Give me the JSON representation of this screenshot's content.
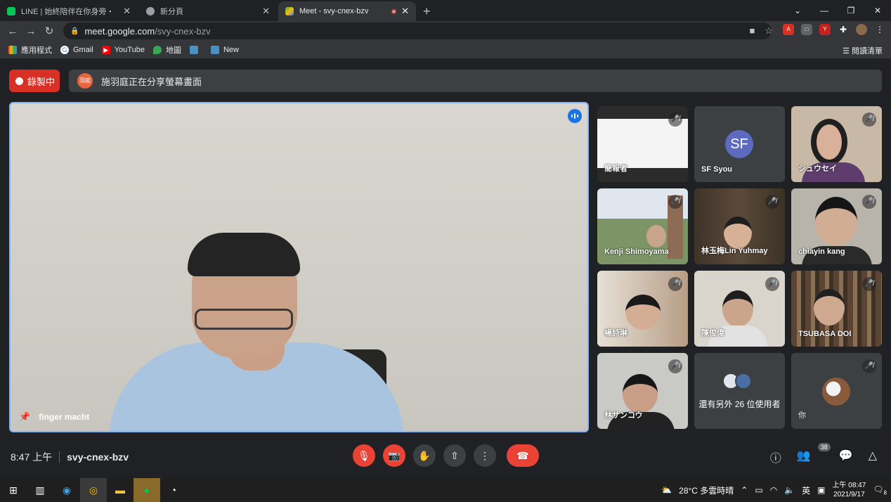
{
  "browser": {
    "tabs": [
      {
        "title": "LINE | 始終陪伴在你身旁・",
        "color": "#06c755"
      },
      {
        "title": "新分頁",
        "color": "#9aa0a6"
      },
      {
        "title": "Meet - svy-cnex-bzv",
        "color": "#34a853",
        "active": true
      }
    ],
    "url_host": "meet.google.com",
    "url_path": "/svy-cnex-bzv",
    "bookmarks": [
      "應用程式",
      "Gmail",
      "YouTube",
      "地圖",
      "New"
    ],
    "reading_list": "閱讀清單"
  },
  "meet": {
    "recording_label": "錄製中",
    "presenter_avatar": "羽庭",
    "share_text": "施羽庭正在分享螢幕畫面",
    "main_speaker": "finger macht",
    "participants": [
      {
        "name": "簡報者",
        "muted": true
      },
      {
        "name": "SF Syou",
        "initials": "SF"
      },
      {
        "name": "シュウセイ",
        "muted": true
      },
      {
        "name": "Kenji Shimoyama",
        "muted": true
      },
      {
        "name": "林玉梅Lin Yuhmay",
        "muted": true
      },
      {
        "name": "chiayin kang",
        "muted": true
      },
      {
        "name": "楊詩琳",
        "muted": true
      },
      {
        "name": "陳俊偉",
        "muted": true
      },
      {
        "name": "TSUBASA DOI",
        "muted": true
      },
      {
        "name": "林サンコウ",
        "muted": true
      },
      {
        "name": "還有另外 26 位使用者"
      },
      {
        "name": "你",
        "muted": true
      }
    ],
    "time": "8:47 上午",
    "meeting_code": "svy-cnex-bzv",
    "people_count": "38"
  },
  "taskbar": {
    "weather": "28°C 多雲時晴",
    "ime": "英",
    "time": "上午 08:47",
    "date": "2021/9/17",
    "notifications": "8"
  }
}
